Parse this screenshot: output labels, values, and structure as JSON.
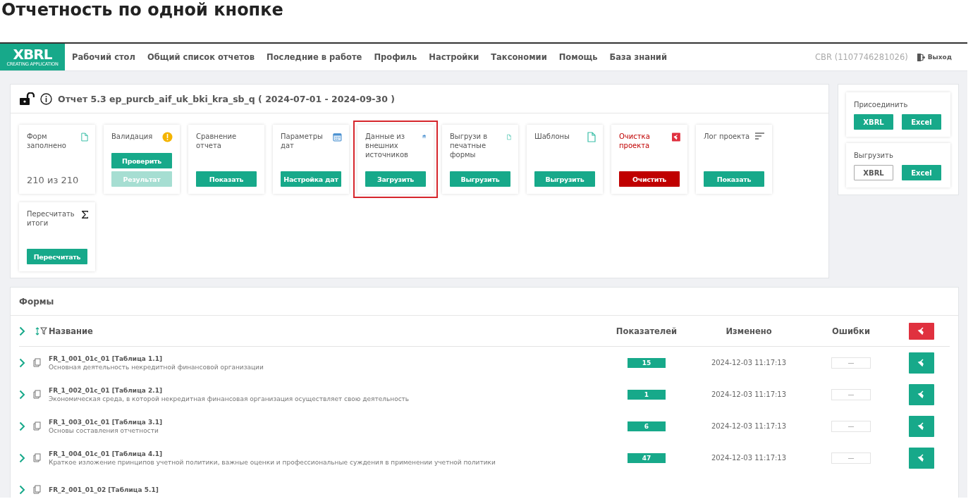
{
  "page_heading": "Отчетность по одной кнопке",
  "navbar": {
    "logo": "XBRL",
    "logo_subtitle": "CREATING APPLICATION",
    "links": [
      "Рабочий стол",
      "Общий список отчетов",
      "Последние в работе",
      "Профиль",
      "Настройки",
      "Таксономии",
      "Помощь",
      "База знаний"
    ],
    "user": "CBR (1107746281026)",
    "logout": "Выход"
  },
  "report": {
    "locked": false,
    "title": "Отчет 5.3 ep_purcb_aif_uk_bki_kra_sb_q ( 2024-07-01 - 2024-09-30 )",
    "tiles": [
      {
        "title": "Форм заполнено",
        "kind": "document",
        "value": "210 из 210",
        "danger": false,
        "highlighted": false
      },
      {
        "title": "Валидация",
        "kind": "warning",
        "danger": false,
        "highlighted": false,
        "buttons": [
          {
            "label": "Проверить",
            "kind": "primary",
            "disabled": false
          },
          {
            "label": "Результат",
            "kind": "primary",
            "disabled": true
          }
        ]
      },
      {
        "title": "Сравнение отчета",
        "kind": "plain",
        "danger": false,
        "highlighted": false,
        "buttons": [
          {
            "label": "Показать",
            "kind": "primary",
            "disabled": false
          }
        ]
      },
      {
        "title": "Параметры дат",
        "kind": "calendar",
        "danger": false,
        "highlighted": false,
        "buttons": [
          {
            "label": "Настройка дат",
            "kind": "primary",
            "disabled": false
          }
        ]
      },
      {
        "title": "Данные из внешних источников",
        "kind": "cloud",
        "danger": false,
        "highlighted": true,
        "buttons": [
          {
            "label": "Загрузить",
            "kind": "primary",
            "disabled": false
          }
        ]
      },
      {
        "title": "Выгрузи в печатные формы",
        "kind": "document",
        "danger": false,
        "highlighted": false,
        "buttons": [
          {
            "label": "Выгрузить",
            "kind": "primary",
            "disabled": false
          }
        ]
      },
      {
        "title": "Шаблоны",
        "kind": "document",
        "danger": false,
        "highlighted": false,
        "buttons": [
          {
            "label": "Выгрузить",
            "kind": "primary",
            "disabled": false
          }
        ]
      },
      {
        "title": "Очистка проекта",
        "kind": "broom",
        "danger": true,
        "highlighted": false,
        "buttons": [
          {
            "label": "Очистить",
            "kind": "danger",
            "disabled": false
          }
        ]
      },
      {
        "title": "Лог проекта",
        "kind": "lines",
        "danger": false,
        "highlighted": false,
        "buttons": [
          {
            "label": "Показать",
            "kind": "primary",
            "disabled": false
          }
        ]
      },
      {
        "title": "Пересчитать итоги",
        "kind": "sigma",
        "danger": false,
        "highlighted": false,
        "buttons": [
          {
            "label": "Пересчитать",
            "kind": "primary",
            "disabled": false
          }
        ]
      }
    ]
  },
  "side": [
    {
      "title": "Присоединить",
      "buttons": [
        {
          "label": "XBRL",
          "kind": "primary"
        },
        {
          "label": "Excel",
          "kind": "primary"
        }
      ]
    },
    {
      "title": "Выгрузить",
      "buttons": [
        {
          "label": "XBRL",
          "kind": "outline"
        },
        {
          "label": "Excel",
          "kind": "primary"
        }
      ]
    }
  ],
  "forms": {
    "title": "Формы",
    "columns": [
      "Название",
      "Показателей",
      "Изменено",
      "Ошибки"
    ],
    "rows": [
      {
        "code": "FR_1_001_01c_01 [Таблица 1.1]",
        "description": "Основная деятельность некредитной финансовой организации",
        "count": "15",
        "modified": "2024-12-03 11:17:13",
        "errors": "—"
      },
      {
        "code": "FR_1_002_01c_01 [Таблица 2.1]",
        "description": "Экономическая среда, в которой некредитная финансовая организация осуществляет свою деятельность",
        "count": "1",
        "modified": "2024-12-03 11:17:13",
        "errors": "—"
      },
      {
        "code": "FR_1_003_01c_01 [Таблица 3.1]",
        "description": "Основы составления отчетности",
        "count": "6",
        "modified": "2024-12-03 11:17:13",
        "errors": "—"
      },
      {
        "code": "FR_1_004_01c_01 [Таблица 4.1]",
        "description": "Краткое изложение принципов учетной политики, важные оценки и профессиональные суждения в применении учетной политики",
        "count": "47",
        "modified": "2024-12-03 11:17:13",
        "errors": "—"
      },
      {
        "code": "FR_2_001_01_02 [Таблица 5.1]"
      }
    ]
  }
}
